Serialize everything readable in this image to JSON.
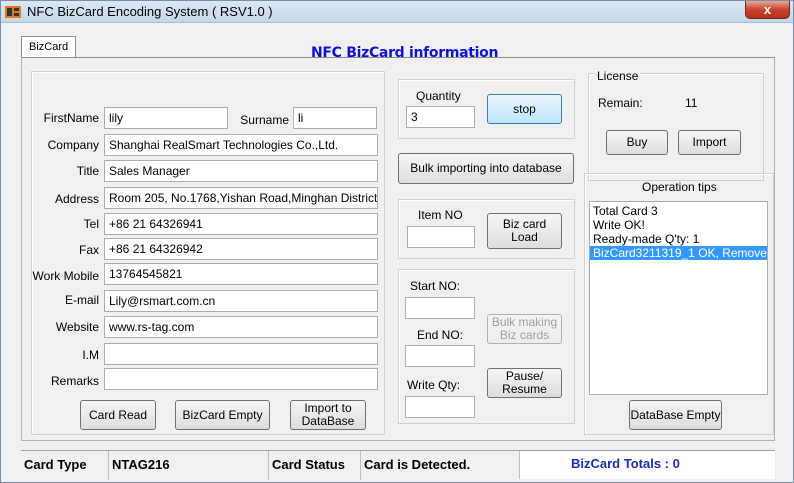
{
  "window": {
    "title": "NFC BizCard Encoding System ( RSV1.0 )",
    "close_label": "x"
  },
  "tab": {
    "label": "BizCard"
  },
  "main_title": "NFC BizCard information",
  "form": {
    "firstname": {
      "label": "FirstName",
      "value": "lily"
    },
    "surname": {
      "label": "Surname",
      "value": "li"
    },
    "company": {
      "label": "Company",
      "value": "Shanghai RealSmart Technologies Co.,Ltd."
    },
    "title": {
      "label": "Title",
      "value": "Sales Manager"
    },
    "address": {
      "label": "Address",
      "value": "Room 205, No.1768,Yishan Road,Minghan District"
    },
    "tel": {
      "label": "Tel",
      "value": "+86 21 64326941"
    },
    "fax": {
      "label": "Fax",
      "value": "+86 21 64326942"
    },
    "work_mobile": {
      "label": "Work Mobile",
      "value": "13764545821"
    },
    "email": {
      "label": "E-mail",
      "value": "Lily@rsmart.com.cn"
    },
    "website": {
      "label": "Website",
      "value": "www.rs-tag.com"
    },
    "im": {
      "label": "I.M",
      "value": ""
    },
    "remarks": {
      "label": "Remarks",
      "value": ""
    }
  },
  "buttons": {
    "card_read": "Card Read",
    "bizcard_empty": "BizCard Empty",
    "import_l1": "Import to",
    "import_l2": "DataBase",
    "stop": "stop",
    "bulk_import": "Bulk importing into database",
    "biz_card_load": "Biz card Load",
    "bulk_making_l1": "Bulk making",
    "bulk_making_l2": "Biz cards",
    "pause_l1": "Pause/",
    "pause_l2": "Resume",
    "buy": "Buy",
    "import": "Import",
    "database_empty": "DataBase Empty"
  },
  "quantity": {
    "label": "Quantity",
    "value": "3"
  },
  "item_no": {
    "label": "Item NO",
    "value": ""
  },
  "batch": {
    "start_label": "Start NO:",
    "start_value": "",
    "end_label": "End NO:",
    "end_value": "",
    "write_qty_label": "Write Qty:",
    "write_qty_value": ""
  },
  "license": {
    "title": "License",
    "remain_label": "Remain:",
    "remain_value": "11"
  },
  "tips": {
    "title": "Operation tips",
    "items": [
      {
        "text": "Total Card 3",
        "selected": false
      },
      {
        "text": "Write OK!",
        "selected": false
      },
      {
        "text": "Ready-made Q'ty: 1",
        "selected": false
      },
      {
        "text": "BizCard3211319_1 OK, Remove",
        "selected": true
      }
    ]
  },
  "status": {
    "card_type_label": "Card Type",
    "card_type_value": "NTAG216",
    "card_status_label": "Card Status",
    "card_status_value": "Card is Detected.",
    "totals": "BizCard Totals : 0"
  },
  "colors": {
    "title_blue": "#1010d0",
    "totals_blue": "#1a2fb0",
    "selection": "#3399ff",
    "close_red": "#c7432c"
  }
}
